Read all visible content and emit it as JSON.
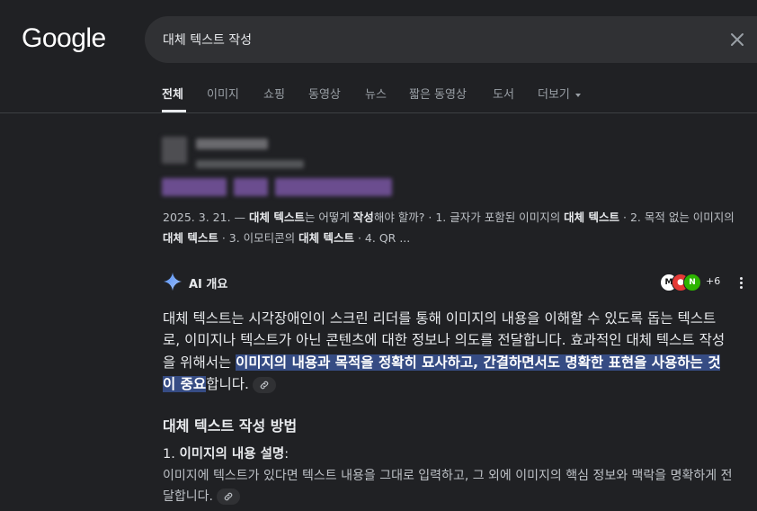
{
  "header": {
    "logo": "Google",
    "search": {
      "value": "대체 텍스트 작성",
      "placeholder": ""
    },
    "tabs": [
      {
        "label": "전체",
        "active": true
      },
      {
        "label": "이미지"
      },
      {
        "label": "쇼핑"
      },
      {
        "label": "동영상"
      },
      {
        "label": "뉴스"
      },
      {
        "label": "짧은 동영상"
      },
      {
        "label": "도서"
      },
      {
        "label": "더보기"
      }
    ]
  },
  "result": {
    "date": "2025. 3. 21.",
    "snippet_parts": [
      "2025. 3. 21. — ",
      "대체 텍스트",
      "는 어떻게 ",
      "작성",
      "해야 할까? · 1. 글자가 포함된 이미지의 ",
      "대체 텍스트",
      " · 2. 목적 없는 이미지의 ",
      "대체 텍스트",
      " · 3. 이모티콘의 ",
      "대체 텍스트",
      " · 4. QR ..."
    ]
  },
  "ai_overview": {
    "label": "AI 개요",
    "sources_extra": "+6",
    "source_icons": [
      "source-logo-m",
      "source-logo-mushroom",
      "source-logo-n"
    ],
    "paragraph": {
      "before": "대체 텍스트는 시각장애인이 스크린 리더를 통해 이미지의 내용을 이해할 수 있도록 돕는 텍스트로, 이미지나 텍스트가 아닌 콘텐츠에 대한 정보나 의도를 전달합니다. 효과적인 대체 텍스트 작성을 위해서는 ",
      "highlight": "이미지의 내용과 목적을 정확히 묘사하고, 간결하면서도 명확한 표현을 사용하는 것이 중요",
      "after": "합니다."
    },
    "section_title": "대체 텍스트 작성 방법",
    "item1": {
      "number": "1.",
      "title": "이미지의 내용 설명",
      "colon": ":",
      "body": "이미지에 텍스트가 있다면 텍스트 내용을 그대로 입력하고, 그 외에 이미지의 핵심 정보와 맥락을 명확하게 전달합니다."
    }
  },
  "colors": {
    "background": "#202124",
    "search_bg": "#303134",
    "highlight": "#364c84",
    "text_primary": "#e8eaed",
    "text_secondary": "#bdc1c6"
  }
}
